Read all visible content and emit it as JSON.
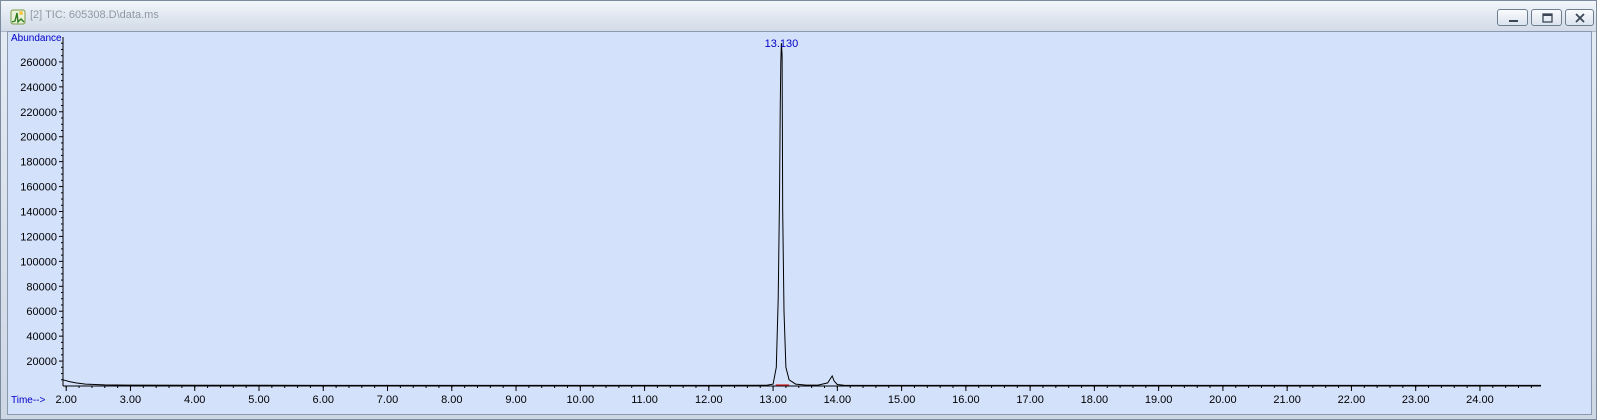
{
  "window": {
    "title": "[2] TIC: 605308.D\\data.ms",
    "icon": "chromatogram-app-icon",
    "buttons": {
      "minimize": "minimize-icon",
      "restore": "restore-icon",
      "close": "close-icon"
    }
  },
  "chart_data": {
    "type": "line",
    "ylabel": "Abundance",
    "xlabel": "Time-->",
    "xlim": [
      1.95,
      24.95
    ],
    "ylim": [
      0,
      280000
    ],
    "x_ticks": [
      "2.00",
      "3.00",
      "4.00",
      "5.00",
      "6.00",
      "7.00",
      "8.00",
      "9.00",
      "10.00",
      "11.00",
      "12.00",
      "13.00",
      "14.00",
      "15.00",
      "16.00",
      "17.00",
      "18.00",
      "19.00",
      "20.00",
      "21.00",
      "22.00",
      "23.00",
      "24.00"
    ],
    "y_ticks": [
      "20000",
      "40000",
      "60000",
      "80000",
      "100000",
      "120000",
      "140000",
      "160000",
      "180000",
      "200000",
      "220000",
      "240000",
      "260000"
    ],
    "peak_label": "13.130",
    "grid": false,
    "series": [
      {
        "color": "#000000",
        "x": [
          1.95,
          2.05,
          2.15,
          2.3,
          2.6,
          3.0,
          4.0,
          5.0,
          6.0,
          7.0,
          8.0,
          9.0,
          10.0,
          11.0,
          12.0,
          12.9,
          13.0,
          13.05,
          13.08,
          13.1,
          13.11,
          13.12,
          13.13,
          13.14,
          13.15,
          13.17,
          13.2,
          13.25,
          13.35,
          13.5,
          13.7,
          13.85,
          13.9,
          13.92,
          13.95,
          14.0,
          14.1,
          15.0,
          16.0,
          17.0,
          18.0,
          19.0,
          20.0,
          21.0,
          22.0,
          23.0,
          24.0,
          24.95
        ],
        "y": [
          5000,
          3500,
          2500,
          1500,
          900,
          700,
          600,
          550,
          500,
          500,
          500,
          500,
          500,
          500,
          500,
          600,
          1500,
          15000,
          70000,
          150000,
          220000,
          260000,
          275000,
          265000,
          140000,
          60000,
          15000,
          5000,
          1500,
          800,
          700,
          2500,
          6500,
          8000,
          4000,
          1200,
          600,
          500,
          500,
          500,
          500,
          500,
          500,
          500,
          500,
          500,
          500,
          500
        ]
      }
    ]
  }
}
